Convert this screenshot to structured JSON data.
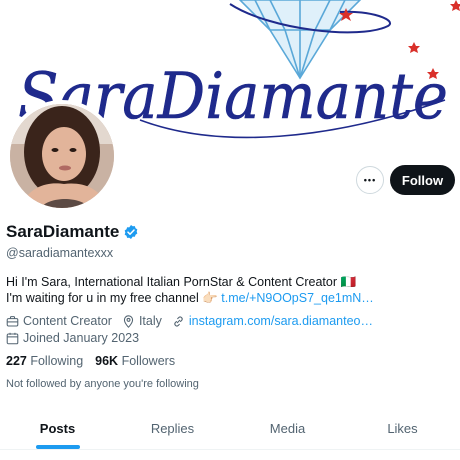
{
  "banner": {
    "logo_text": "SaraDiamante"
  },
  "profile": {
    "display_name": "SaraDiamante",
    "handle": "@saradiamantexxx",
    "verified": true,
    "bio_line1": "Hi I'm Sara, International Italian PornStar & Content Creator",
    "bio_flag": "🇮🇹",
    "bio_line2_text": "I'm waiting for u in my free channel",
    "bio_line2_emoji": "👉🏻",
    "bio_link": "t.me/+N9OOpS7_qe1mN…",
    "category": "Content Creator",
    "location": "Italy",
    "website": "instagram.com/sara.diamanteo…",
    "joined": "Joined January 2023",
    "following_count": "227",
    "following_label": "Following",
    "followers_count": "96K",
    "followers_label": "Followers",
    "followed_note": "Not followed by anyone you're following"
  },
  "actions": {
    "more_label": "•••",
    "follow_label": "Follow"
  },
  "tabs": [
    {
      "label": "Posts",
      "active": true
    },
    {
      "label": "Replies",
      "active": false
    },
    {
      "label": "Media",
      "active": false
    },
    {
      "label": "Likes",
      "active": false
    }
  ],
  "colors": {
    "accent": "#1d9bf0",
    "text_primary": "#0f1419",
    "text_secondary": "#536471",
    "logo_navy": "#1f2a8c",
    "diamond_blue": "#5aa8d8"
  }
}
